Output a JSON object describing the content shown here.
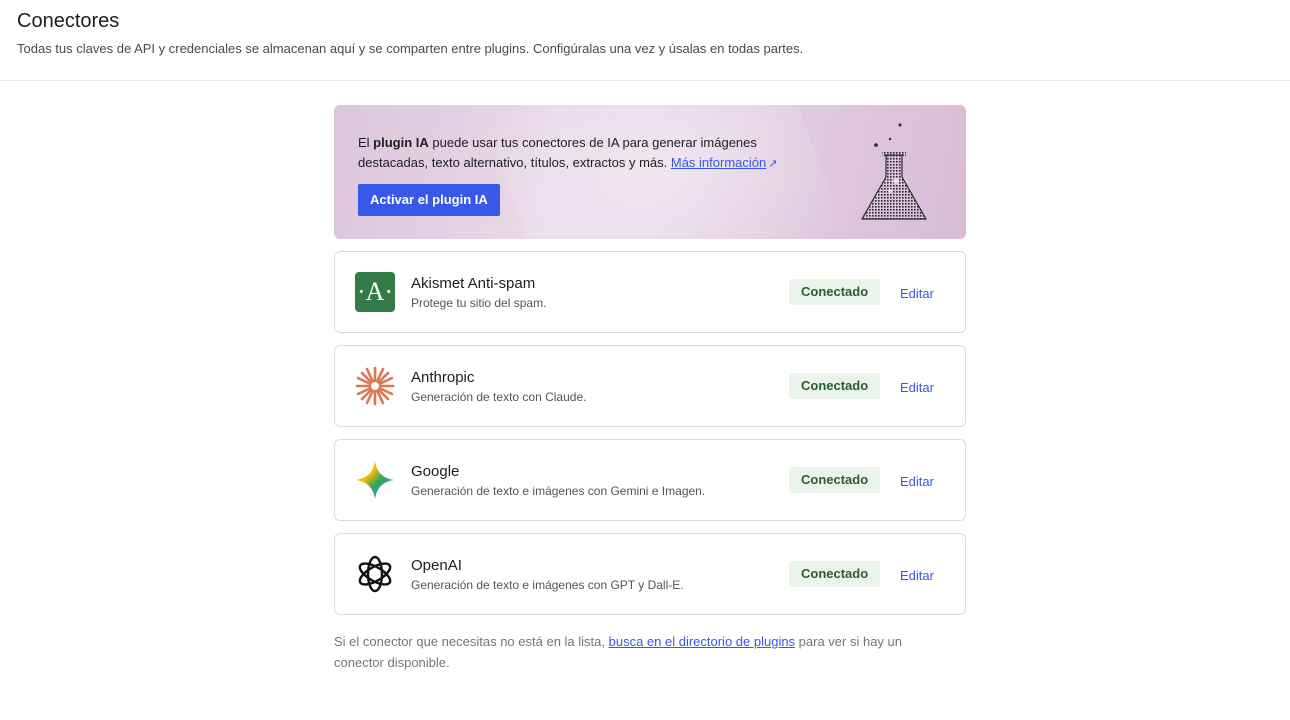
{
  "header": {
    "title": "Conectores",
    "subtitle": "Todas tus claves de API y credenciales se almacenan aquí y se comparten entre plugins. Configúralas una vez y úsalas en todas partes."
  },
  "promo": {
    "text_pre": "El ",
    "text_bold": "plugin IA",
    "text_post": " puede usar tus conectores de IA para generar imágenes destacadas, texto alternativo, títulos, extractos y más. ",
    "link_text": "Más información",
    "link_icon": "↗",
    "button_label": "Activar el plugin IA",
    "icon": "flask-icon"
  },
  "connectors": [
    {
      "name": "Akismet Anti-spam",
      "description": "Protege tu sitio del spam.",
      "status": "Conectado",
      "edit_label": "Editar",
      "icon": "akismet-icon",
      "logo_letter": "·A·"
    },
    {
      "name": "Anthropic",
      "description": "Generación de texto con Claude.",
      "status": "Conectado",
      "edit_label": "Editar",
      "icon": "anthropic-icon"
    },
    {
      "name": "Google",
      "description": "Generación de texto e imágenes con Gemini e Imagen.",
      "status": "Conectado",
      "edit_label": "Editar",
      "icon": "gemini-icon"
    },
    {
      "name": "OpenAI",
      "description": "Generación de texto e imágenes con GPT y Dall-E.",
      "status": "Conectado",
      "edit_label": "Editar",
      "icon": "openai-icon"
    }
  ],
  "footer": {
    "text_pre": "Si el conector que necesitas no está en la lista, ",
    "link_text": "busca en el directorio de plugins",
    "text_post": " para ver si hay un conector disponible."
  },
  "colors": {
    "accent": "#3858e9",
    "badge_bg": "#eaf4ea",
    "badge_text": "#2c5f2e",
    "akismet_green": "#357b49",
    "anthropic_orange": "#d97757"
  }
}
